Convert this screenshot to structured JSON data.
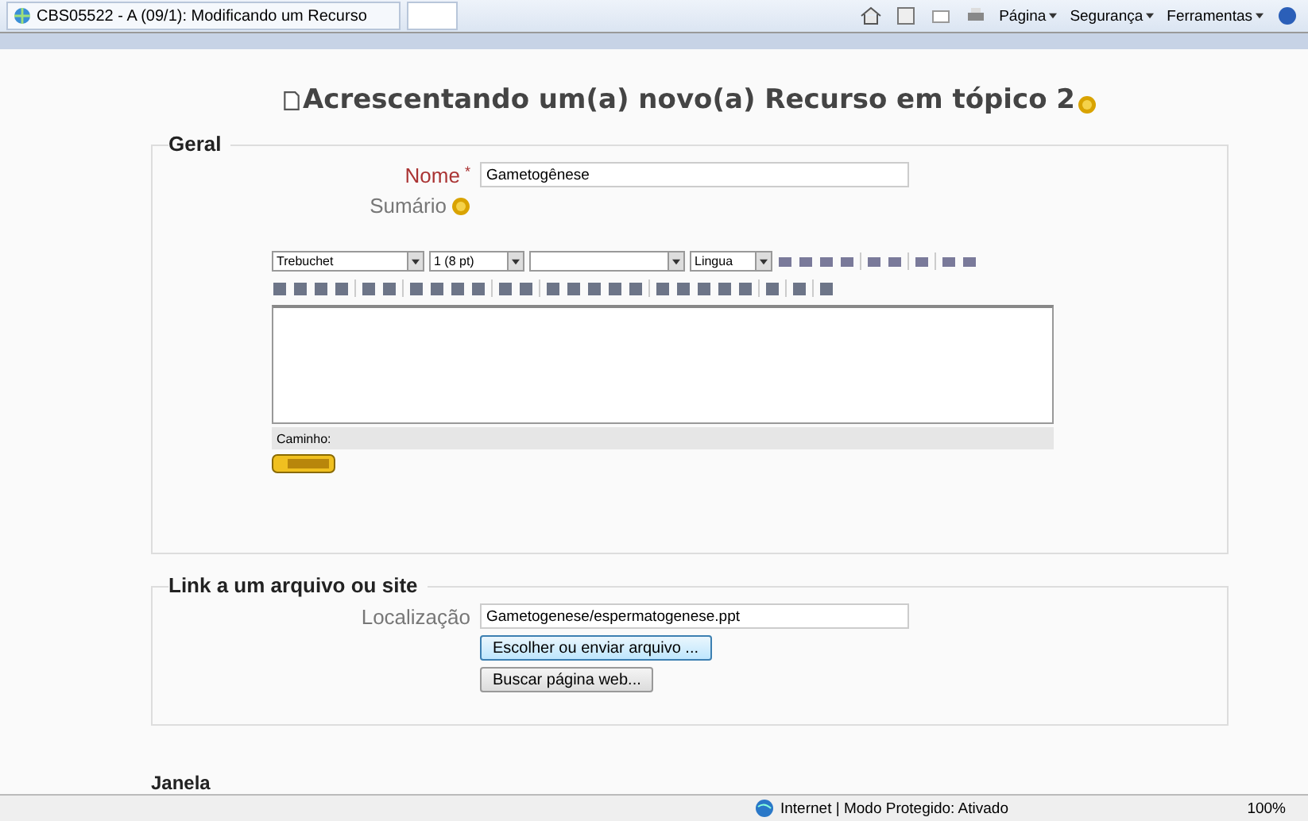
{
  "browser": {
    "tab_title": "CBS05522 - A (09/1): Modificando um Recurso",
    "commands": [
      "Página",
      "Segurança",
      "Ferramentas"
    ]
  },
  "heading": "Acrescentando um(a) novo(a) Recurso em tópico 2",
  "geral": {
    "legend": "Geral",
    "name_label": "Nome",
    "required_mark": "*",
    "name_value": "Gametogênese",
    "summary_label": "Sumário",
    "editor": {
      "font": "Trebuchet",
      "size": "1 (8 pt)",
      "language": "Lingua",
      "path_label": "Caminho:"
    }
  },
  "link": {
    "legend": "Link a um arquivo ou site",
    "location_label": "Localização",
    "location_value": "Gametogenese/espermatogenese.ppt",
    "buttons": [
      {
        "label": "Escolher ou enviar arquivo ...",
        "focused": true
      },
      {
        "label": "Buscar página web...",
        "focused": false
      }
    ]
  },
  "next_legend": "Janela",
  "status_bar": {
    "zone": "Internet | Modo Protegido: Ativado",
    "zoom": "100%"
  }
}
